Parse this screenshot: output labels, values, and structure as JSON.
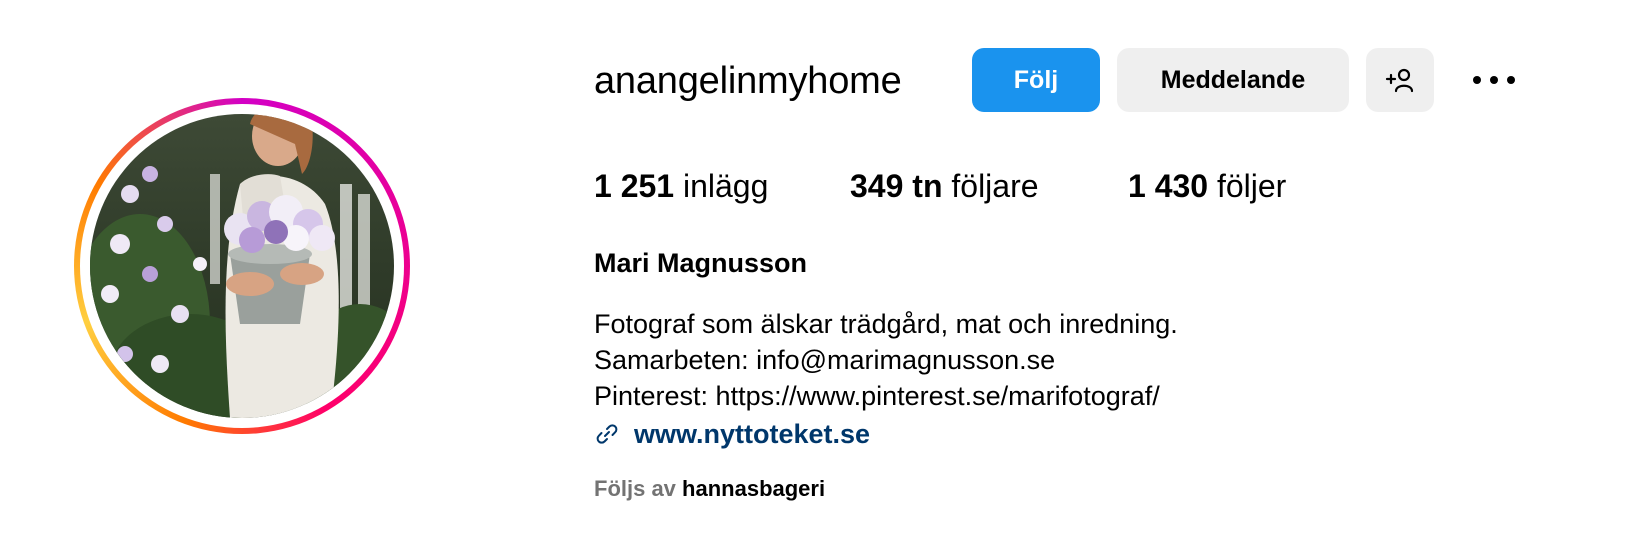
{
  "profile": {
    "username": "anangelinmyhome",
    "full_name": "Mari Magnusson",
    "avatar_icon": "profile-photo",
    "story_ring_colors": [
      "#d300c5",
      "#ff0069",
      "#ff7a00",
      "#ffcf40"
    ]
  },
  "actions": {
    "follow_label": "Följ",
    "follow_color": "#1a93ee",
    "message_label": "Meddelande",
    "add_user_icon": "person-plus-icon",
    "more_icon": "ellipsis-icon"
  },
  "stats": {
    "posts_count": "1 251",
    "posts_label": "inlägg",
    "followers_count": "349 tn",
    "followers_label": "följare",
    "following_count": "1 430",
    "following_label": "följer"
  },
  "bio": {
    "lines": [
      "Fotograf som älskar trädgård, mat och inredning.",
      "Samarbeten: info@marimagnusson.se",
      "Pinterest: https://www.pinterest.se/marifotograf/"
    ],
    "link_icon": "link-icon",
    "link_text": "www.nyttoteket.se",
    "link_color": "#00376b"
  },
  "followed_by": {
    "prefix": "Följs av",
    "user": "hannasbageri"
  }
}
